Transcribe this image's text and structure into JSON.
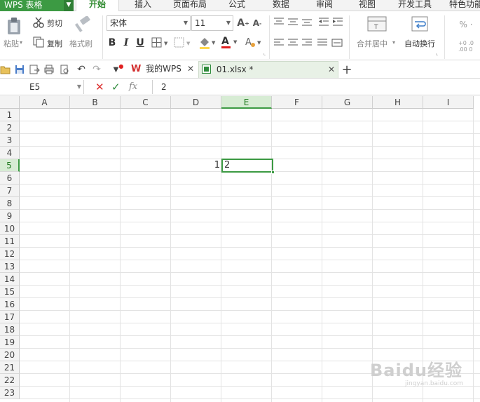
{
  "app": {
    "title": "WPS 表格"
  },
  "menu": [
    "开始",
    "插入",
    "页面布局",
    "公式",
    "数据",
    "审阅",
    "视图",
    "开发工具",
    "特色功能"
  ],
  "ribbon": {
    "paste": "粘贴",
    "cut": "剪切",
    "copy": "复制",
    "format_painter": "格式刷",
    "font_name": "宋体",
    "font_size": "11",
    "merge_center": "合并居中",
    "wrap_text": "自动换行"
  },
  "tabs": [
    {
      "label": "我的WPS"
    },
    {
      "label": "01.xlsx *"
    }
  ],
  "formula_bar": {
    "cell_ref": "E5",
    "value": "2",
    "fx_label": "fx"
  },
  "columns": [
    "A",
    "B",
    "C",
    "D",
    "E",
    "F",
    "G",
    "H",
    "I"
  ],
  "rows": [
    "1",
    "2",
    "3",
    "4",
    "5",
    "6",
    "7",
    "8",
    "9",
    "10",
    "11",
    "12",
    "13",
    "14",
    "15",
    "16",
    "17",
    "18",
    "19",
    "20",
    "21",
    "22",
    "23"
  ],
  "cells": {
    "D5": "1",
    "E5": "2"
  },
  "selection": {
    "column": "E",
    "row": "5"
  },
  "watermark": {
    "text": "Baidu经验",
    "sub": "jingyan.baidu.com"
  },
  "colors": {
    "accent": "#3c9a43"
  }
}
